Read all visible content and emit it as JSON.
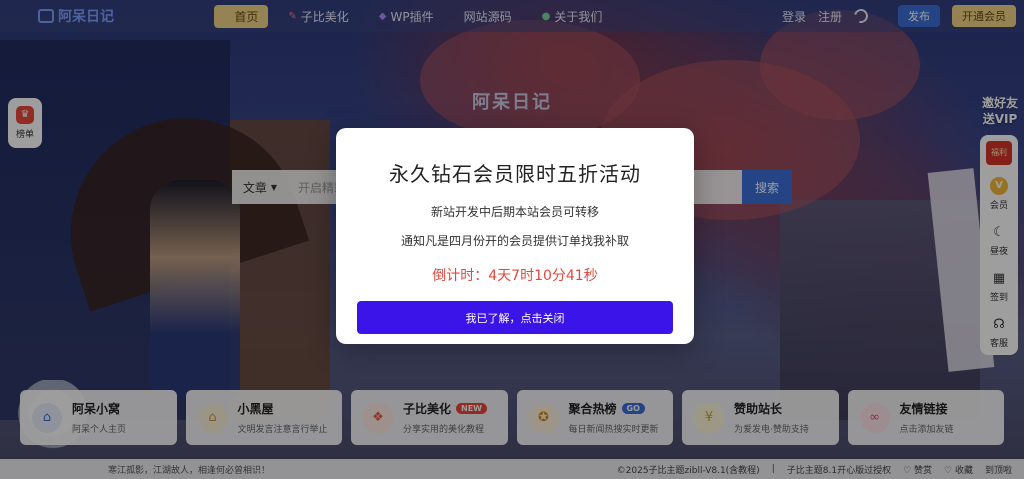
{
  "header": {
    "logo": "阿呆日记",
    "nav": [
      {
        "label": "首页",
        "icon": "home-icon"
      },
      {
        "label": "子比美化",
        "icon": "brush-icon"
      },
      {
        "label": "WP插件",
        "icon": "plugin-icon"
      },
      {
        "label": "网站源码",
        "icon": "code-icon"
      },
      {
        "label": "关于我们",
        "icon": "info-icon"
      }
    ],
    "login": "登录",
    "register": "注册",
    "publish": "发布",
    "vip": "开通会员"
  },
  "scene": {
    "title": "阿呆日记"
  },
  "left_float": {
    "label": "榜单"
  },
  "right_rail": {
    "invite": "邀好友送VIP",
    "redbag": "福利",
    "items": [
      "会员",
      "昼夜",
      "签到",
      "客服"
    ]
  },
  "hero_search": {
    "category": "文章",
    "placeholder": "开启精彩搜索",
    "button": "搜索"
  },
  "cards": [
    {
      "title": "阿呆小窝",
      "sub": "阿呆个人主页",
      "icon_bg": "#e9eefc",
      "icon_color": "#3b6fd8",
      "icon": "home-icon",
      "badge": "",
      "badge_color": ""
    },
    {
      "title": "小黑屋",
      "sub": "文明发言注意言行举止",
      "icon_bg": "#fbf1dc",
      "icon_color": "#c9962f",
      "icon": "house-icon",
      "badge": "",
      "badge_color": ""
    },
    {
      "title": "子比美化",
      "sub": "分享实用的美化教程",
      "icon_bg": "#fde8e4",
      "icon_color": "#e35a3f",
      "icon": "gift-icon",
      "badge": "NEW",
      "badge_color": "#e8473b"
    },
    {
      "title": "聚合热榜",
      "sub": "每日新闻热搜实时更新",
      "icon_bg": "#fdf3dc",
      "icon_color": "#d08a1e",
      "icon": "medal-icon",
      "badge": "GO",
      "badge_color": "#3b6fd8"
    },
    {
      "title": "赞助站长",
      "sub": "为爱发电·赞助支持",
      "icon_bg": "#fdf6d8",
      "icon_color": "#c9a81f",
      "icon": "coin-icon",
      "badge": "",
      "badge_color": ""
    },
    {
      "title": "友情链接",
      "sub": "点击添加友链",
      "icon_bg": "#fde4ea",
      "icon_color": "#e0456a",
      "icon": "link-icon",
      "badge": "",
      "badge_color": ""
    }
  ],
  "footer": {
    "left": "寒江孤影，江湖故人，相逢何必曾相识！",
    "copyright": "©2025子比主题zibll-V8.1(含教程)",
    "theme": "子比主题8.1开心版过授权",
    "appreciate": "赞赏",
    "favorite": "收藏",
    "top": "到顶啦"
  },
  "modal": {
    "title": "永久钻石会员限时五折活动",
    "line1": "新站开发中后期本站会员可转移",
    "line2": "通知凡是四月份开的会员提供订单找我补取",
    "countdown": "倒计时：4天7时10分41秒",
    "button": "我已了解，点击关闭"
  }
}
